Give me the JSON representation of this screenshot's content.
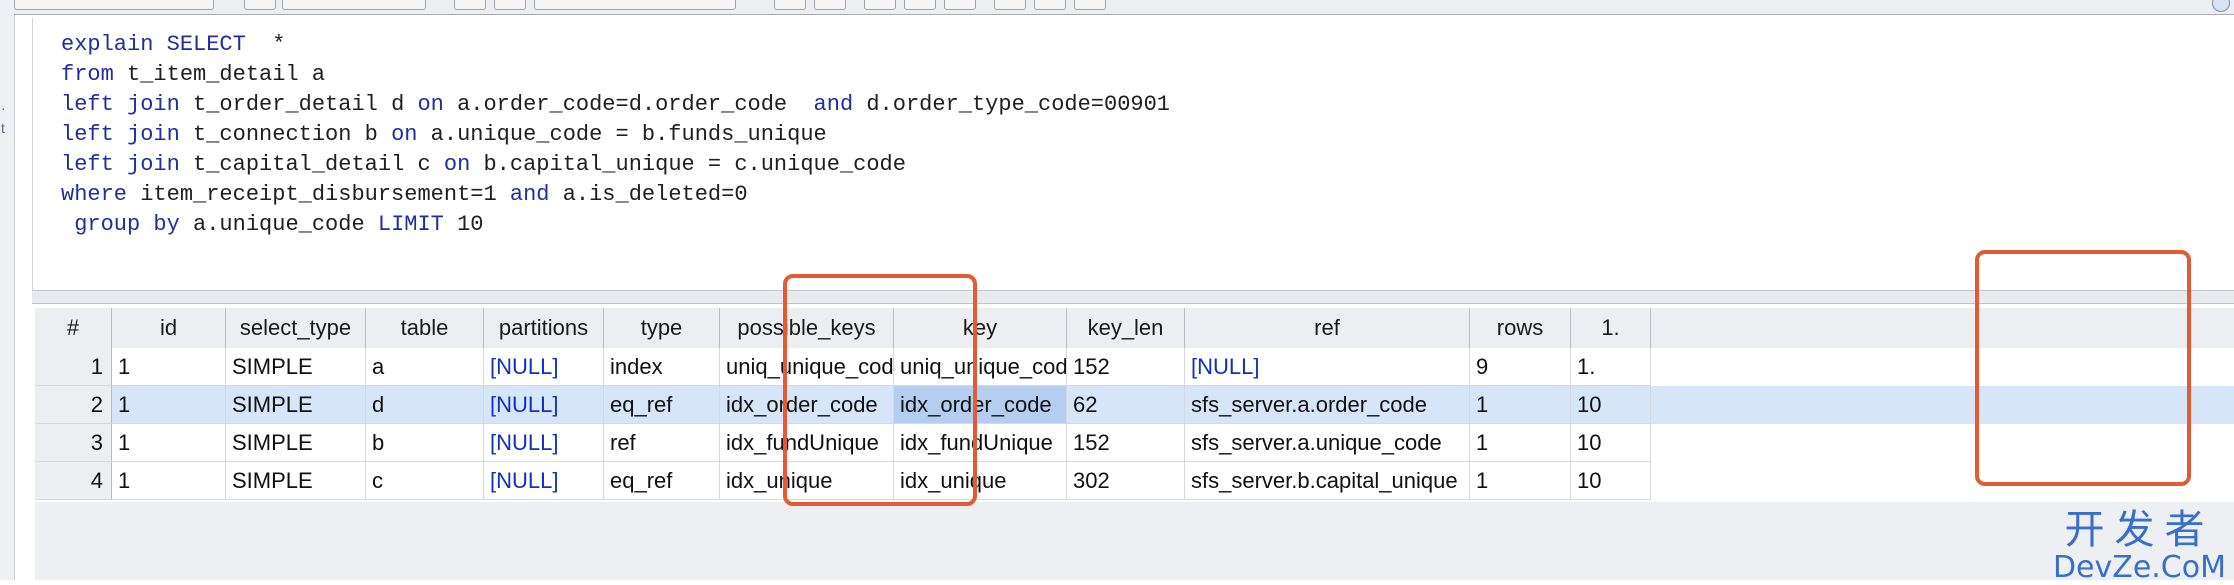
{
  "editor": {
    "lines": [
      [
        {
          "t": "explain SELECT",
          "k": true
        },
        {
          "t": "  *",
          "k": false
        }
      ],
      [
        {
          "t": "from",
          "k": true
        },
        {
          "t": " t_item_detail a",
          "k": false
        }
      ],
      [
        {
          "t": "left join",
          "k": true
        },
        {
          "t": " t_order_detail d ",
          "k": false
        },
        {
          "t": "on",
          "k": true
        },
        {
          "t": " a.order_code=d.order_code  ",
          "k": false
        },
        {
          "t": "and",
          "k": true
        },
        {
          "t": " d.order_type_code=00901",
          "k": false
        }
      ],
      [
        {
          "t": "left join",
          "k": true
        },
        {
          "t": " t_connection b ",
          "k": false
        },
        {
          "t": "on",
          "k": true
        },
        {
          "t": " a.unique_code = b.funds_unique",
          "k": false
        }
      ],
      [
        {
          "t": "left join",
          "k": true
        },
        {
          "t": " t_capital_detail c ",
          "k": false
        },
        {
          "t": "on",
          "k": true
        },
        {
          "t": " b.capital_unique = c.unique_code",
          "k": false
        }
      ],
      [
        {
          "t": "where",
          "k": true
        },
        {
          "t": " item_receipt_disbursement=1 ",
          "k": false
        },
        {
          "t": "and",
          "k": true
        },
        {
          "t": " a.is_deleted=0",
          "k": false
        }
      ],
      [
        {
          "t": " group by",
          "k": true
        },
        {
          "t": " a.unique_code ",
          "k": false
        },
        {
          "t": "LIMIT",
          "k": true
        },
        {
          "t": " 10",
          "k": false
        }
      ]
    ]
  },
  "grid": {
    "columns": [
      "#",
      "id",
      "select_type",
      "table",
      "partitions",
      "type",
      "possible_keys",
      "key",
      "key_len",
      "ref",
      "rows",
      "1."
    ],
    "rows": [
      [
        "1",
        "1",
        "SIMPLE",
        "a",
        "[NULL]",
        "index",
        "uniq_unique_code",
        "uniq_unique_code",
        "152",
        "[NULL]",
        "9",
        "1."
      ],
      [
        "2",
        "1",
        "SIMPLE",
        "d",
        "[NULL]",
        "eq_ref",
        "idx_order_code",
        "idx_order_code",
        "62",
        "sfs_server.a.order_code",
        "1",
        "10"
      ],
      [
        "3",
        "1",
        "SIMPLE",
        "b",
        "[NULL]",
        "ref",
        "idx_fundUnique",
        "idx_fundUnique",
        "152",
        "sfs_server.a.unique_code",
        "1",
        "10"
      ],
      [
        "4",
        "1",
        "SIMPLE",
        "c",
        "[NULL]",
        "eq_ref",
        "idx_unique",
        "idx_unique",
        "302",
        "sfs_server.b.capital_unique",
        "1",
        "10"
      ]
    ],
    "selected_row": 1,
    "highlighted_cell": {
      "row": 1,
      "col": 7
    }
  },
  "watermark": {
    "top": "开发者",
    "bottom": "DevZe.CoM"
  },
  "colors": {
    "annotation": "#e35a34",
    "keyword": "#1f2fa0",
    "null": "#1530c0",
    "selection": "#d6e5f8"
  },
  "gutter": {
    "glyphs": [
      "·",
      "t"
    ]
  }
}
